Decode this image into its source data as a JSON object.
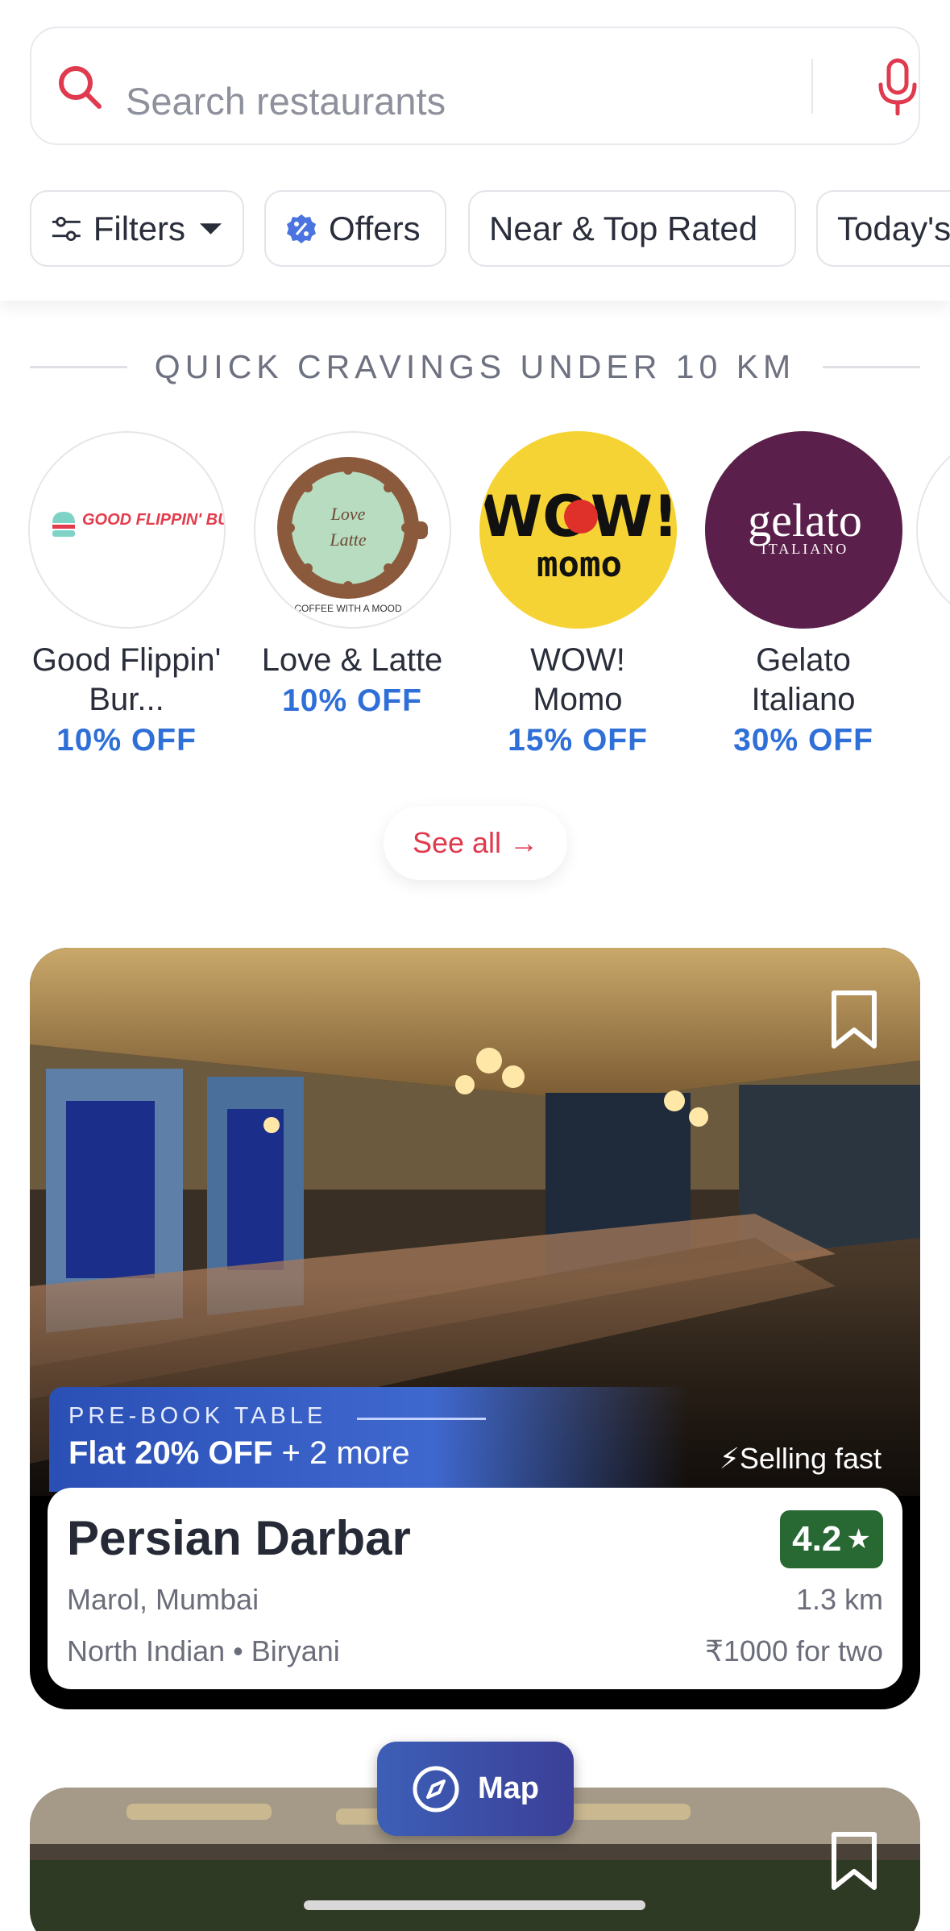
{
  "search": {
    "placeholder": "Search restaurants"
  },
  "chips": [
    {
      "label": "Filters",
      "icon": "sliders-icon"
    },
    {
      "label": "Offers",
      "icon": "discount-badge-icon"
    },
    {
      "label": "Near & Top Rated",
      "icon": ""
    },
    {
      "label": "Today's",
      "icon": ""
    }
  ],
  "section": {
    "title": "QUICK CRAVINGS UNDER 10 KM",
    "see_all": "See all →"
  },
  "cravings": [
    {
      "name": "Good Flippin' Bur...",
      "offer": "10% OFF",
      "logo_text": "GOOD FLIPPIN' BURGERS"
    },
    {
      "name": "Love & Latte",
      "offer": "10% OFF",
      "logo_text": "Love & Latte",
      "logo_sub": "COFFEE WITH A MOOD"
    },
    {
      "name": "WOW! Momo",
      "offer": "15% OFF",
      "logo_text": "WOW!",
      "logo_sub": "momo"
    },
    {
      "name": "Gelato Italiano",
      "offer": "30% OFF",
      "logo_text": "gelato",
      "logo_sub": "ITALIANO"
    }
  ],
  "card": {
    "promo_label": "PRE-BOOK TABLE",
    "promo_main_bold": "Flat 20% OFF",
    "promo_main_rest": " + 2 more",
    "selling": "⚡Selling fast",
    "name": "Persian Darbar",
    "rating": "4.2",
    "location": "Marol, Mumbai",
    "distance": "1.3 km",
    "cuisines": "North Indian • Biryani",
    "price": "₹1000 for two"
  },
  "map_button": {
    "label": "Map"
  },
  "colors": {
    "brand_red": "#e03a4e",
    "offer_blue": "#2f6fd8",
    "rating_green": "#276833"
  }
}
